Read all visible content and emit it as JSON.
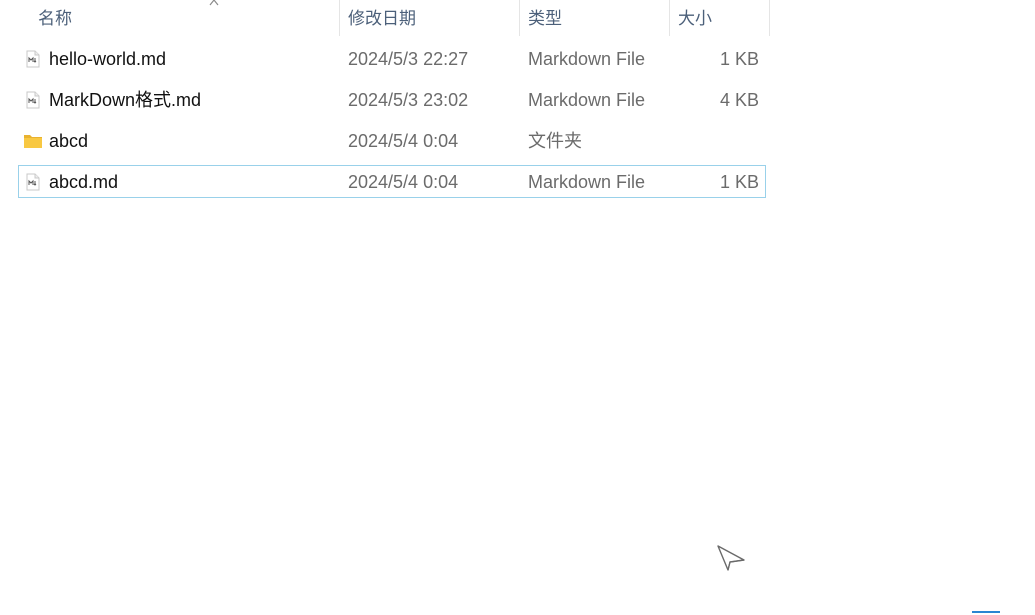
{
  "header": {
    "name_label": "名称",
    "date_label": "修改日期",
    "type_label": "类型",
    "size_label": "大小",
    "sort_column": "name",
    "sort_direction": "ascending"
  },
  "files": [
    {
      "name": "hello-world.md",
      "modified": "2024/5/3 22:27",
      "type": "Markdown File",
      "size": "1 KB",
      "icon": "markdown-file-icon"
    },
    {
      "name": "MarkDown格式.md",
      "modified": "2024/5/3 23:02",
      "type": "Markdown File",
      "size": "4 KB",
      "icon": "markdown-file-icon"
    },
    {
      "name": "abcd",
      "modified": "2024/5/4 0:04",
      "type": "文件夹",
      "size": "",
      "icon": "folder-icon"
    },
    {
      "name": "abcd.md",
      "modified": "2024/5/4 0:04",
      "type": "Markdown File",
      "size": "1 KB",
      "icon": "markdown-file-icon",
      "focused": true
    }
  ],
  "colors": {
    "header_text": "#4c607a",
    "focus_border": "#99d1ea",
    "folder_yellow": "#f8c842"
  }
}
